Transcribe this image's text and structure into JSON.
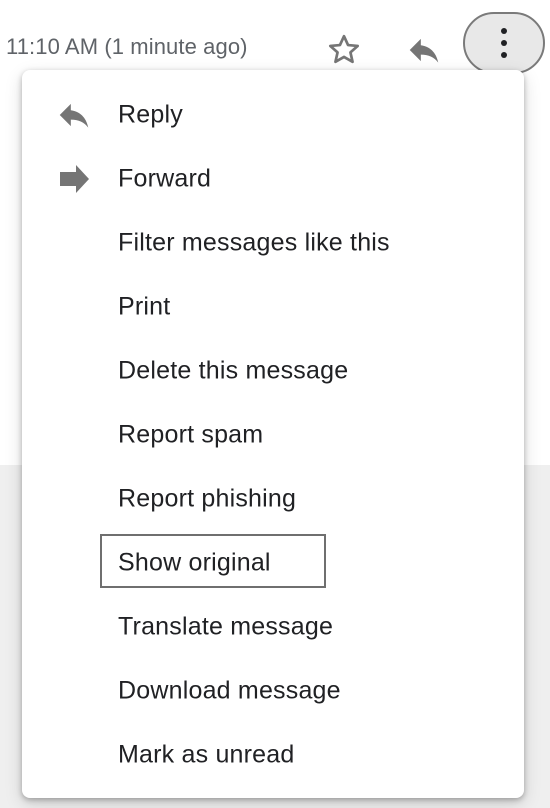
{
  "header": {
    "timestamp": "11:10 AM (1 minute ago)",
    "star_icon": "star-outline-icon",
    "reply_icon": "reply-icon",
    "more_icon": "more-vertical-icon"
  },
  "menu": {
    "items": [
      {
        "label": "Reply",
        "icon": "reply-icon"
      },
      {
        "label": "Forward",
        "icon": "forward-icon"
      },
      {
        "label": "Filter messages like this"
      },
      {
        "label": "Print"
      },
      {
        "label": "Delete this message"
      },
      {
        "label": "Report spam"
      },
      {
        "label": "Report phishing"
      },
      {
        "label": "Show original",
        "focused": true
      },
      {
        "label": "Translate message"
      },
      {
        "label": "Download message"
      },
      {
        "label": "Mark as unread"
      }
    ]
  },
  "colors": {
    "icon_gray": "#757575",
    "text": "#202124",
    "secondary_text": "#5f6368",
    "focus_ring": "#6f6f6f"
  }
}
